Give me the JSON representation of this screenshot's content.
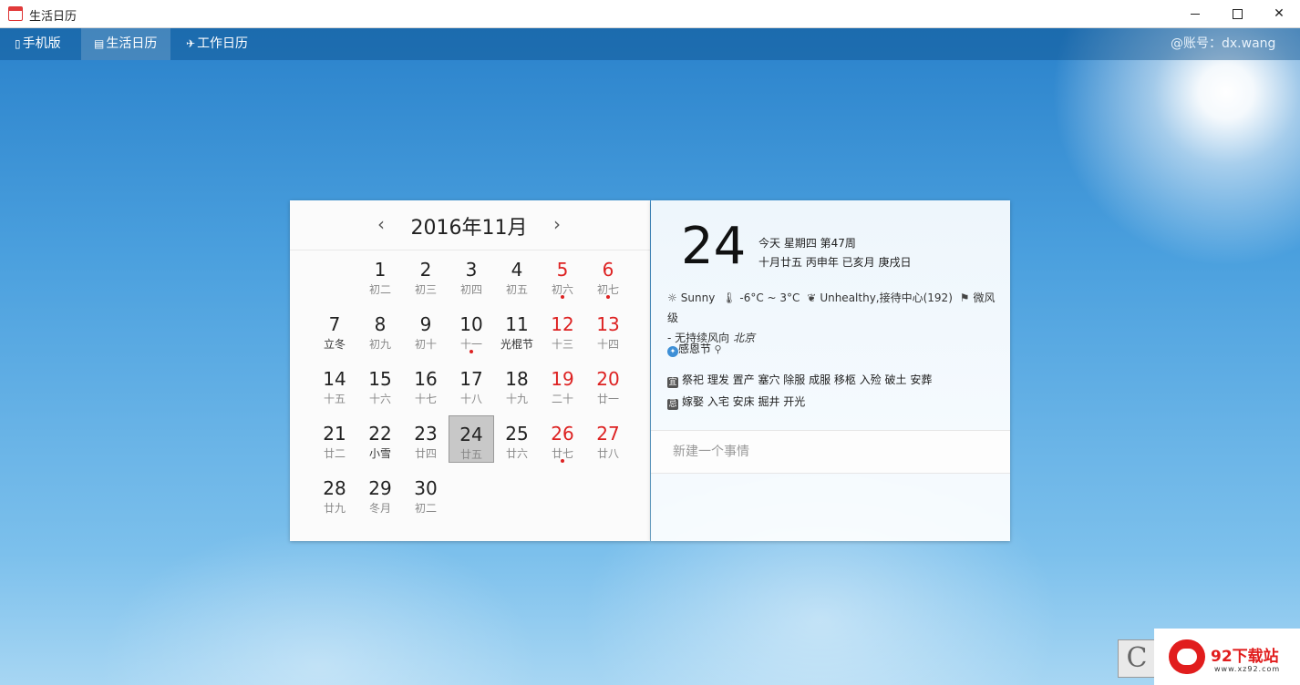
{
  "window": {
    "title": "生活日历",
    "minimize": "–",
    "maximize": "☐",
    "close": "✕"
  },
  "nav": {
    "phone": "手机版",
    "life": "生活日历",
    "work": "工作日历",
    "account": "@账号：dx.wang"
  },
  "calendar": {
    "prev": "‹",
    "next": "›",
    "title": "2016年11月",
    "days": [
      {
        "n": "1",
        "l": "初二"
      },
      {
        "n": "2",
        "l": "初三"
      },
      {
        "n": "3",
        "l": "初四"
      },
      {
        "n": "4",
        "l": "初五"
      },
      {
        "n": "5",
        "l": "初六"
      },
      {
        "n": "6",
        "l": "初七"
      },
      {
        "n": "7",
        "l": "立冬"
      },
      {
        "n": "8",
        "l": "初九"
      },
      {
        "n": "9",
        "l": "初十"
      },
      {
        "n": "10",
        "l": "十一"
      },
      {
        "n": "11",
        "l": "光棍节"
      },
      {
        "n": "12",
        "l": "十三"
      },
      {
        "n": "13",
        "l": "十四"
      },
      {
        "n": "14",
        "l": "十五"
      },
      {
        "n": "15",
        "l": "十六"
      },
      {
        "n": "16",
        "l": "十七"
      },
      {
        "n": "17",
        "l": "十八"
      },
      {
        "n": "18",
        "l": "十九"
      },
      {
        "n": "19",
        "l": "二十"
      },
      {
        "n": "20",
        "l": "廿一"
      },
      {
        "n": "21",
        "l": "廿二"
      },
      {
        "n": "22",
        "l": "小雪"
      },
      {
        "n": "23",
        "l": "廿四"
      },
      {
        "n": "24",
        "l": "廿五"
      },
      {
        "n": "25",
        "l": "廿六"
      },
      {
        "n": "26",
        "l": "廿七"
      },
      {
        "n": "27",
        "l": "廿八"
      },
      {
        "n": "28",
        "l": "廿九"
      },
      {
        "n": "29",
        "l": "冬月"
      },
      {
        "n": "30",
        "l": "初二"
      }
    ]
  },
  "detail": {
    "day": "24",
    "line1": "今天 星期四 第47周",
    "line2": "十月廿五 丙申年 已亥月 庚戌日",
    "weather": "Sunny",
    "temp": "-6°C ~ 3°C",
    "aqi": "Unhealthy,接待中心(192)",
    "wind": "微风级",
    "wind2": "- 无持续风向",
    "city": "北京",
    "holiday": "感恩节",
    "yi": "祭祀 理发 置产 塞穴 除服 成服 移柩 入殓 破土 安葬",
    "ji": "嫁娶 入宅 安床 掘井 开光",
    "yi_tag": "宜",
    "ji_tag": "忌",
    "new_event_placeholder": "新建一个事情"
  },
  "watermark": {
    "c": "C",
    "text": "92下载站",
    "url": "www.xz92.com"
  }
}
